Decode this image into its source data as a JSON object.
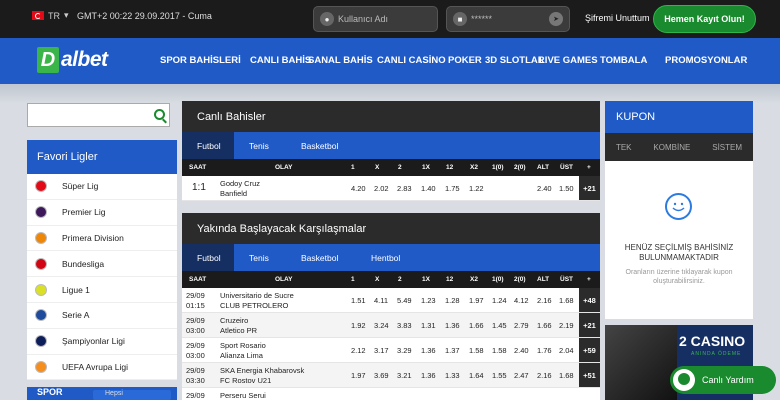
{
  "top": {
    "lang": "TR",
    "datetime": "GMT+2 00:22 29.09.2017 - Cuma",
    "username_placeholder": "Kullanıcı Adı",
    "password_mask": "******",
    "forgot": "Şifremi Unuttum",
    "register": "Hemen Kayıt Olun!"
  },
  "brand": {
    "logo_mark": "D",
    "logo_text": "albet"
  },
  "nav": [
    "SPOR BAHİSLERİ",
    "CANLI BAHİS",
    "SANAL BAHİS",
    "CANLI CASİNO",
    "POKER",
    "3D SLOTLAR",
    "LIVE GAMES",
    "TOMBALA",
    "PROMOSYONLAR"
  ],
  "sidebar": {
    "title": "Favori Ligler",
    "items": [
      "Süper Lig",
      "Premier Lig",
      "Primera Division",
      "Bundesliga",
      "Ligue 1",
      "Serie A",
      "Şampiyonlar Ligi",
      "UEFA Avrupa Ligi"
    ],
    "sports_label": "SPOR",
    "sports_select": "Hepsi"
  },
  "live": {
    "title": "Canlı Bahisler",
    "tabs": [
      "Futbol",
      "Tenis",
      "Basketbol"
    ],
    "headers": [
      "SAAT",
      "OLAY",
      "1",
      "X",
      "2",
      "1X",
      "12",
      "X2",
      "1(0)",
      "2(0)",
      "ALT",
      "ÜST",
      "+"
    ],
    "rows": [
      {
        "score": "1:1",
        "home": "Godoy Cruz",
        "away": "Banfield",
        "odds": [
          "4.20",
          "2.02",
          "2.83",
          "1.40",
          "1.75",
          "1.22",
          "",
          "",
          "2.40",
          "1.50"
        ],
        "more": "+21"
      }
    ]
  },
  "upcoming": {
    "title": "Yakında Başlayacak Karşılaşmalar",
    "tabs": [
      "Futbol",
      "Tenis",
      "Basketbol",
      "Hentbol"
    ],
    "headers": [
      "SAAT",
      "OLAY",
      "1",
      "X",
      "2",
      "1X",
      "12",
      "X2",
      "1(0)",
      "2(0)",
      "ALT",
      "ÜST",
      "+"
    ],
    "rows": [
      {
        "date": "29/09",
        "time": "01:15",
        "home": "Universitario de Sucre",
        "away": "CLUB PETROLERO",
        "odds": [
          "1.51",
          "4.11",
          "5.49",
          "1.23",
          "1.28",
          "1.97",
          "1.24",
          "4.12",
          "2.16",
          "1.68"
        ],
        "more": "+48"
      },
      {
        "date": "29/09",
        "time": "03:00",
        "home": "Cruzeiro",
        "away": "Atletico PR",
        "odds": [
          "1.92",
          "3.24",
          "3.83",
          "1.31",
          "1.36",
          "1.66",
          "1.45",
          "2.79",
          "1.66",
          "2.19"
        ],
        "more": "+21"
      },
      {
        "date": "29/09",
        "time": "03:00",
        "home": "Sport Rosario",
        "away": "Alianza Lima",
        "odds": [
          "2.12",
          "3.17",
          "3.29",
          "1.36",
          "1.37",
          "1.58",
          "1.58",
          "2.40",
          "1.76",
          "2.04"
        ],
        "more": "+59"
      },
      {
        "date": "29/09",
        "time": "03:30",
        "home": "SKA Energia Khabarovsk",
        "away": "FC Rostov U21",
        "odds": [
          "1.97",
          "3.69",
          "3.21",
          "1.36",
          "1.33",
          "1.64",
          "1.55",
          "2.47",
          "2.16",
          "1.68"
        ],
        "more": "+51"
      },
      {
        "date": "29/09",
        "time": "",
        "home": "Perseru Serui",
        "away": "",
        "odds": [
          "",
          "",
          "",
          "",
          "",
          "",
          "",
          "",
          "",
          ""
        ],
        "more": ""
      }
    ]
  },
  "coupon": {
    "title": "KUPON",
    "tabs": [
      "TEK",
      "KOMBİNE",
      "SİSTEM"
    ],
    "empty": "HENÜZ SEÇİLMİŞ BAHİSİNİZ BULUNMAMAKTADIR",
    "hint": "Oranların üzerine tıklayarak kupon oluşturabilirsiniz."
  },
  "banner": {
    "title": "2 CASINO",
    "subtitle": "ANINDA ÖDEME"
  },
  "chat": {
    "label": "Canlı Yardım"
  },
  "colors": {
    "blue": "#1f5ac7",
    "dark": "#2b2b2b",
    "green": "#1a8a2e"
  }
}
